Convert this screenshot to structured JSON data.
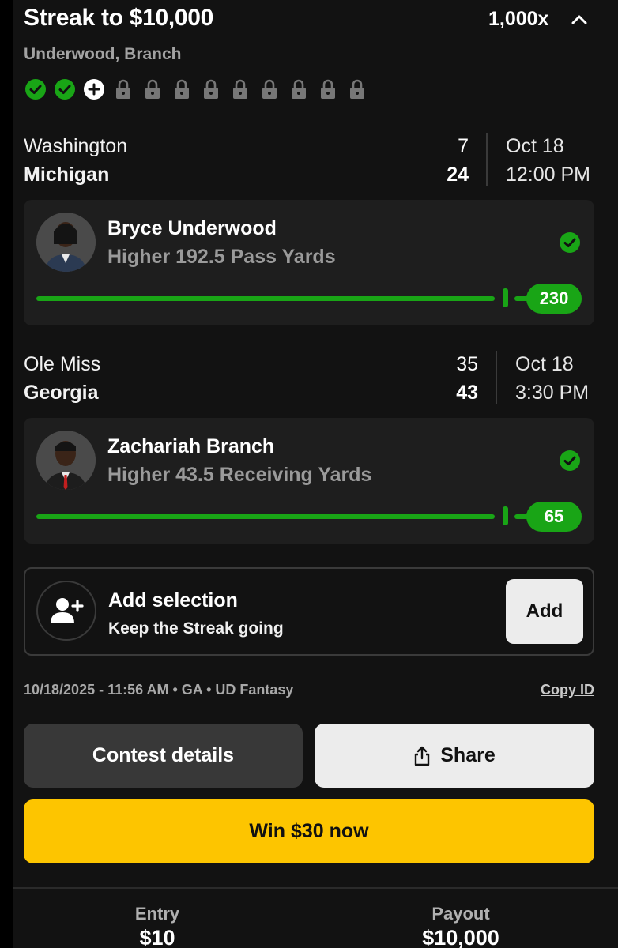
{
  "header": {
    "title": "Streak to $10,000",
    "multiplier": "1,000x",
    "subtitle": "Underwood, Branch",
    "steps": [
      "completed",
      "completed",
      "add",
      "locked",
      "locked",
      "locked",
      "locked",
      "locked",
      "locked",
      "locked",
      "locked"
    ]
  },
  "games": [
    {
      "away_team": "Washington",
      "away_score": "7",
      "home_team": "Michigan",
      "home_score": "24",
      "date": "Oct 18",
      "time": "12:00 PM",
      "pick": {
        "player": "Bryce Underwood",
        "line": "Higher 192.5 Pass Yards",
        "result": "230",
        "status": "won"
      }
    },
    {
      "away_team": "Ole Miss",
      "away_score": "35",
      "home_team": "Georgia",
      "home_score": "43",
      "date": "Oct 18",
      "time": "3:30 PM",
      "pick": {
        "player": "Zachariah Branch",
        "line": "Higher 43.5 Receiving Yards",
        "result": "65",
        "status": "won"
      }
    }
  ],
  "add_selection": {
    "title": "Add selection",
    "subtitle": "Keep the Streak going",
    "button": "Add"
  },
  "meta": {
    "info": "10/18/2025 - 11:56 AM • GA • UD Fantasy",
    "copy_id": "Copy ID"
  },
  "actions": {
    "contest_details": "Contest details",
    "share": "Share",
    "win_now": "Win $30 now"
  },
  "footer": {
    "entry_label": "Entry",
    "entry_value": "$10",
    "payout_label": "Payout",
    "payout_value": "$10,000"
  },
  "colors": {
    "accent_green": "#19a516",
    "cta_yellow": "#fdc500",
    "background": "#121212",
    "card": "#1e1e1e"
  }
}
